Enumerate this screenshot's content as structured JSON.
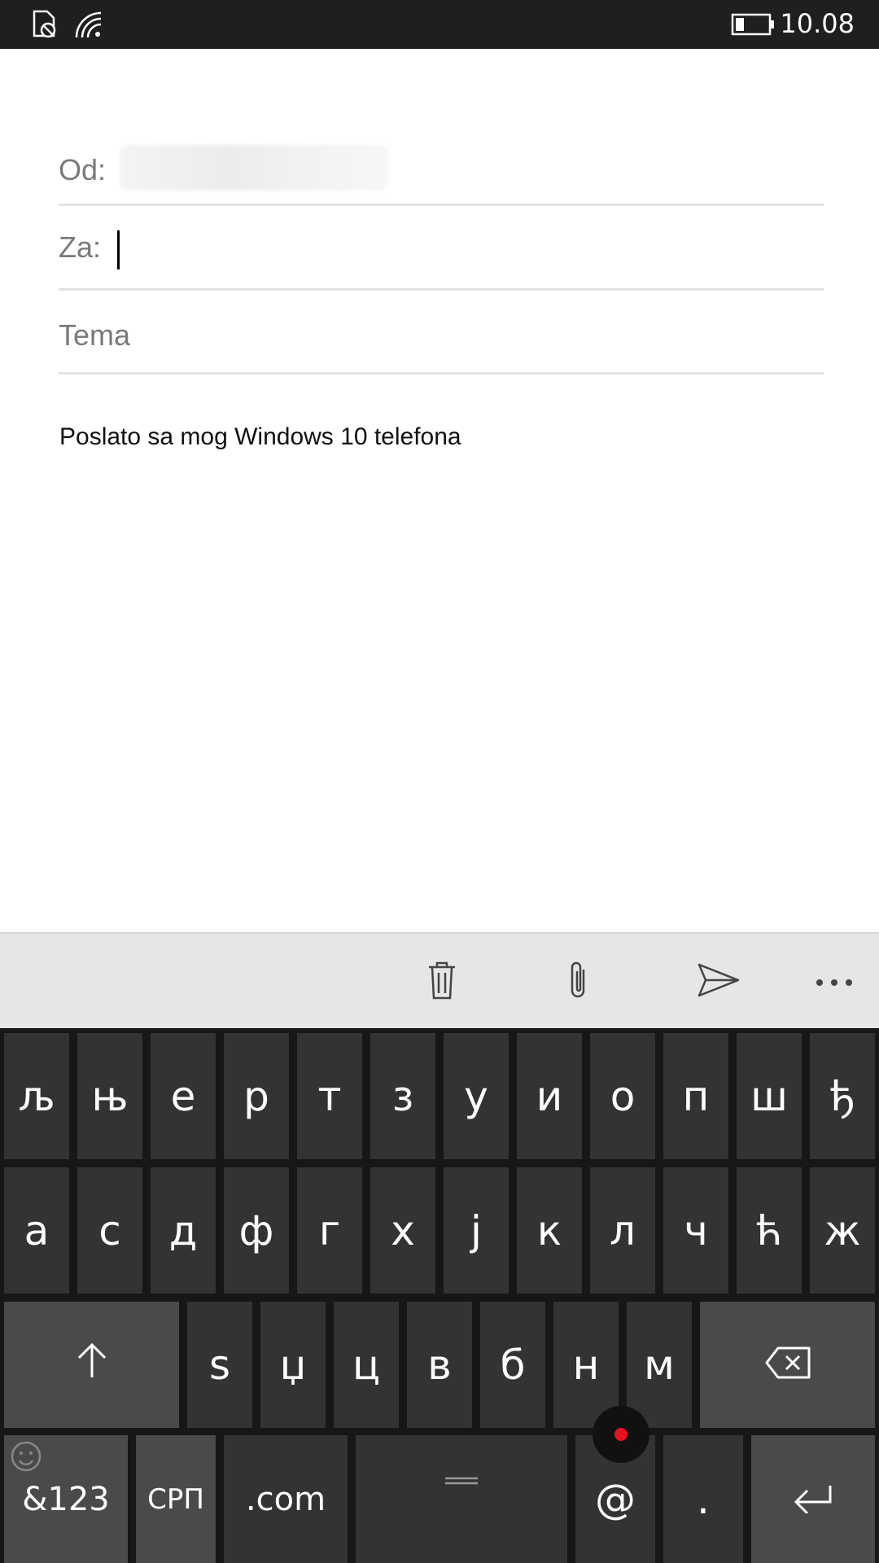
{
  "status_bar": {
    "time": "10.08",
    "icons": [
      "sim-disabled-icon",
      "wifi-icon",
      "battery-icon"
    ]
  },
  "compose": {
    "from_label": "Od:",
    "to_label": "Za:",
    "subject_placeholder": "Tema",
    "signature": "Poslato sa mog Windows 10 telefona"
  },
  "app_bar": {
    "icons": [
      "delete-icon",
      "attach-icon",
      "send-icon",
      "more-icon"
    ]
  },
  "keyboard": {
    "row1": [
      "љ",
      "њ",
      "е",
      "р",
      "т",
      "з",
      "у",
      "и",
      "о",
      "п",
      "ш",
      "ђ"
    ],
    "row2": [
      "а",
      "с",
      "д",
      "ф",
      "г",
      "х",
      "ј",
      "к",
      "л",
      "ч",
      "ћ",
      "ж"
    ],
    "row3": [
      "ѕ",
      "џ",
      "ц",
      "в",
      "б",
      "н",
      "м"
    ],
    "symbols_label": "&123",
    "language_label": "СРП",
    "dotcom_label": ".com",
    "at_label": "@",
    "period_label": "."
  }
}
